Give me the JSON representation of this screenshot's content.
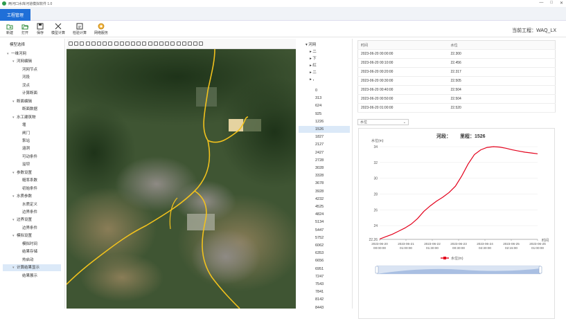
{
  "window": {
    "title": "两河口水库河道模拟软件 1.0",
    "min": "—",
    "max": "□",
    "close": "✕"
  },
  "tabs": [
    {
      "label": "工程管理"
    }
  ],
  "toolbar": [
    {
      "label": "新建",
      "icon": "folder-new-icon"
    },
    {
      "label": "打开",
      "icon": "folder-open-icon"
    },
    {
      "label": "保存",
      "icon": "save-icon"
    },
    {
      "label": "模型计算",
      "icon": "compute-icon"
    },
    {
      "label": "检验计算",
      "icon": "check-calc-icon"
    },
    {
      "label": "网络服务",
      "icon": "network-icon"
    }
  ],
  "project": {
    "label": "当前工程：",
    "name": "WAQ_LX"
  },
  "sidebar": {
    "header": "模型选择",
    "items": [
      {
        "label": "一维河网",
        "level": 0,
        "caret": "▾"
      },
      {
        "label": "河网编辑",
        "level": 1,
        "caret": "▾"
      },
      {
        "label": "河网节点",
        "level": 2
      },
      {
        "label": "河段",
        "level": 2
      },
      {
        "label": "汊点",
        "level": 2
      },
      {
        "label": "计算断面",
        "level": 2
      },
      {
        "label": "断面编辑",
        "level": 1,
        "caret": "▾"
      },
      {
        "label": "断面数据",
        "level": 2
      },
      {
        "label": "水工建筑物",
        "level": 1,
        "caret": "▾"
      },
      {
        "label": "堰",
        "level": 2
      },
      {
        "label": "闸门",
        "level": 2
      },
      {
        "label": "泵站",
        "level": 2
      },
      {
        "label": "涵洞",
        "level": 2
      },
      {
        "label": "可动条件",
        "level": 2
      },
      {
        "label": "溢坝",
        "level": 2
      },
      {
        "label": "参数设置",
        "level": 1,
        "caret": "▾"
      },
      {
        "label": "糙率系数",
        "level": 2
      },
      {
        "label": "初始条件",
        "level": 2
      },
      {
        "label": "水质参数",
        "level": 1,
        "caret": "▾"
      },
      {
        "label": "水质定义",
        "level": 2
      },
      {
        "label": "边界条件",
        "level": 2
      },
      {
        "label": "边界设置",
        "level": 1,
        "caret": "▾"
      },
      {
        "label": "边界条件",
        "level": 2
      },
      {
        "label": "模拟设置",
        "level": 1,
        "caret": "▾"
      },
      {
        "label": "模拟时间",
        "level": 2
      },
      {
        "label": "结果存储",
        "level": 2
      },
      {
        "label": "热启动",
        "level": 2
      },
      {
        "label": "计算结果显示",
        "level": 1,
        "caret": "▾",
        "selected": true
      },
      {
        "label": "结果展示",
        "level": 2
      }
    ]
  },
  "mileages": {
    "root": "河网",
    "children": [
      {
        "label": "二"
      },
      {
        "label": "下"
      },
      {
        "label": "红"
      },
      {
        "label": "二"
      },
      {
        "label": "，"
      }
    ],
    "values": [
      "0",
      "313",
      "624",
      "925",
      "1226",
      "1526",
      "1827",
      "2127",
      "2427",
      "2728",
      "3028",
      "3328",
      "3678",
      "3928",
      "4232",
      "4525",
      "4824",
      "5134",
      "5447",
      "5752",
      "6062",
      "6353",
      "6656",
      "6951",
      "7247",
      "7543",
      "7841",
      "8142",
      "8443"
    ],
    "selected": "1526"
  },
  "table": {
    "headers": [
      "时间",
      "水位"
    ],
    "rows": [
      [
        "2023-06-20 00:00:00",
        "22.300"
      ],
      [
        "2023-06-20 00:10:00",
        "22.456"
      ],
      [
        "2023-06-20 00:20:00",
        "22.317"
      ],
      [
        "2023-06-20 00:30:00",
        "22.505"
      ],
      [
        "2023-06-20 00:40:00",
        "22.504"
      ],
      [
        "2023-06-20 00:50:00",
        "22.504"
      ],
      [
        "2023-06-20 01:00:00",
        "22.520"
      ]
    ]
  },
  "dropdown": {
    "value": "水位",
    "arrow": "⌄"
  },
  "chart_data": {
    "type": "line",
    "title_prefix": "河段：",
    "title_mid": "里程：",
    "mileage": "1526",
    "ylabel": "水位(m)",
    "xlabel": "时间",
    "ylim": [
      22.26,
      34
    ],
    "yticks": [
      "22.26",
      "24",
      "26",
      "28",
      "30",
      "32",
      "34"
    ],
    "xticks": [
      "2023-06-20 00:00:00",
      "2023-06-21 01:00:00",
      "2023-06-22 01:30:00",
      "2023-06-23 00:30:00",
      "2023-06-24 02:30:00",
      "2023-06-25 02:15:00",
      "2023-06-26 01:00:00"
    ],
    "series": [
      {
        "name": "水位(m)",
        "color": "#e3001b",
        "x": [
          0,
          0.4,
          0.8,
          1.2,
          1.6,
          2.0,
          2.4,
          2.8,
          3.2,
          3.6,
          4.0,
          4.4,
          4.8,
          5.2,
          5.6,
          6.0,
          6.4,
          6.8,
          7.2,
          7.6,
          8.0,
          8.4,
          8.8,
          9.2,
          9.6,
          10.0
        ],
        "values": [
          22.3,
          22.6,
          22.9,
          23.3,
          23.7,
          24.2,
          24.9,
          25.8,
          26.5,
          27.1,
          27.6,
          28.2,
          29.0,
          30.3,
          31.8,
          33.0,
          33.6,
          33.9,
          34.0,
          33.95,
          33.8,
          33.6,
          33.45,
          33.3,
          33.2,
          33.1
        ]
      }
    ]
  }
}
